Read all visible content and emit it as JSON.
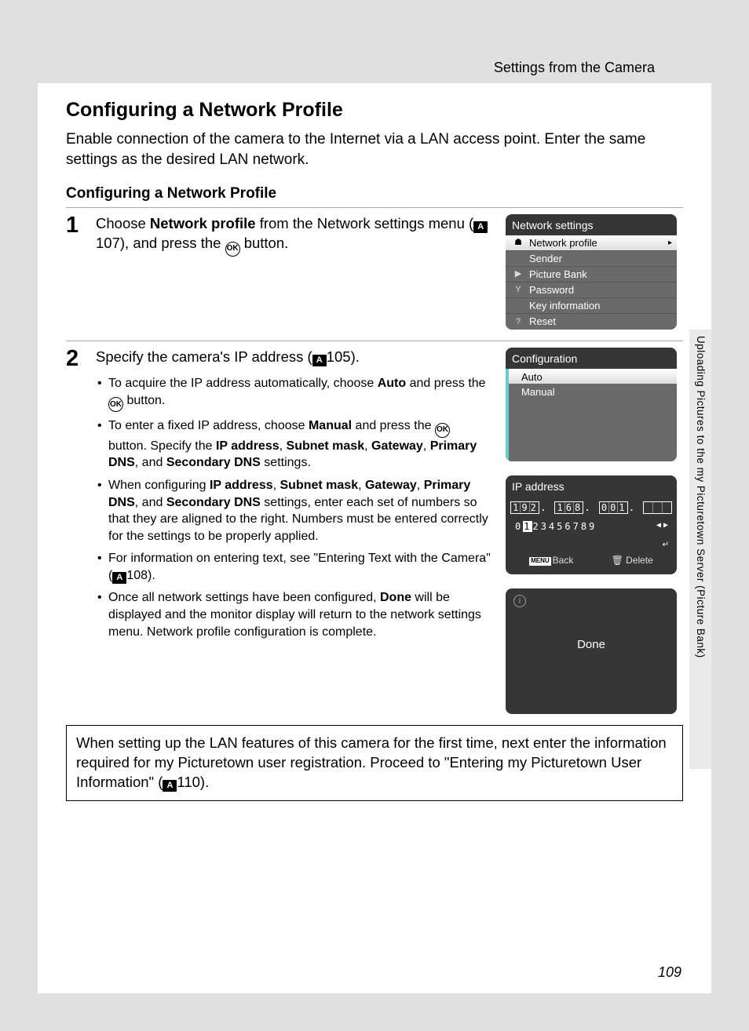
{
  "header": "Settings from the Camera",
  "mainHeading": "Configuring a Network Profile",
  "intro": "Enable connection of the camera to the Internet via a LAN access point. Enter the same settings as the desired LAN network.",
  "subHeading": "Configuring a Network Profile",
  "step1": {
    "num": "1",
    "t1": "Choose ",
    "t1b": "Network profile",
    "t2": " from the Network settings menu (",
    "refIcon": "A",
    "ref": "107",
    "t3": "), and press the ",
    "ok": "OK",
    "t4": " button."
  },
  "step2": {
    "num": "2",
    "t1": "Specify the camera's IP address (",
    "refIcon": "A",
    "ref": "105",
    "t2": ").",
    "b1a": "To acquire the IP address automatically, choose ",
    "b1b": "Auto",
    "b1c": " and press the ",
    "b1d": " button.",
    "b2a": "To enter a fixed IP address, choose ",
    "b2b": "Manual",
    "b2c": " and press the ",
    "b2d": " button.  Specify the ",
    "b2e": "IP address",
    "b2f": ", ",
    "b2g": "Subnet mask",
    "b2h": ", ",
    "b2i": "Gateway",
    "b2j": ", ",
    "b2k": "Primary DNS",
    "b2l": ", and ",
    "b2m": "Secondary DNS",
    "b2n": " settings.",
    "b3a": "When configuring ",
    "b3b": "IP address",
    "b3c": ", ",
    "b3d": "Subnet mask",
    "b3e": ", ",
    "b3f": "Gateway",
    "b3g": ", ",
    "b3h": "Primary DNS",
    "b3i": ", and ",
    "b3j": "Secondary DNS",
    "b3k": " settings, enter each set of numbers so that they are aligned to the right. Numbers must be entered correctly for the settings to be properly applied.",
    "b4a": "For information on entering text, see \"Entering Text with the Camera\" (",
    "b4ref": "108",
    "b4b": ").",
    "b5a": "Once all network settings have been configured, ",
    "b5b": "Done",
    "b5c": " will be displayed and the monitor display will return to the network settings menu. Network profile configuration is complete."
  },
  "cam1": {
    "title": "Network settings",
    "items": [
      "Network profile",
      "Sender",
      "Picture Bank",
      "Password",
      "Key information",
      "Reset"
    ]
  },
  "cam2": {
    "title": "Configuration",
    "auto": "Auto",
    "manual": "Manual"
  },
  "cam3": {
    "title": "IP address",
    "octets": [
      "192",
      "168",
      "001",
      ""
    ],
    "digits": "0123456789",
    "back": "Back",
    "delete": "Delete"
  },
  "cam4": {
    "done": "Done"
  },
  "note": {
    "t1": "When setting up the LAN features of this camera for the first time, next enter the information required for my Picturetown user registration. Proceed to \"Entering my Picturetown User Information\" (",
    "ref": "110",
    "t2": ")."
  },
  "sideTab": "Uploading Pictures to the my Picturetown Server (Picture Bank)",
  "pageNum": "109"
}
